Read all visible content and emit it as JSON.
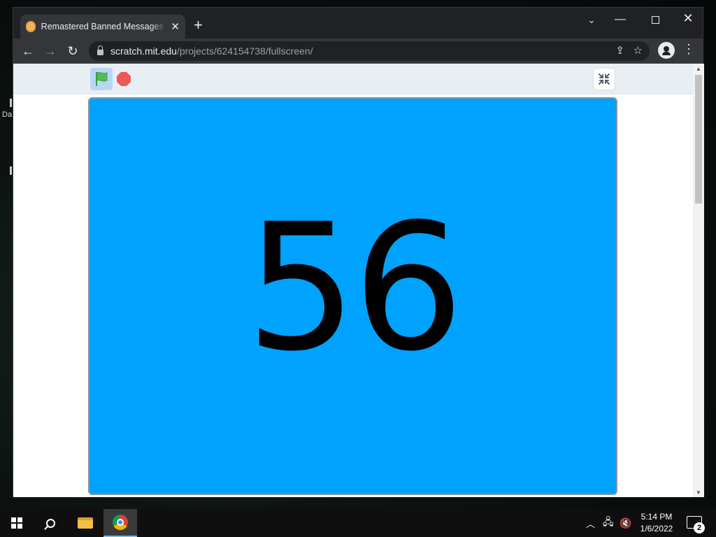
{
  "desktop": {
    "partial_label": "Da"
  },
  "browser": {
    "tab_title": "Remastered Banned Messages Pa",
    "url_host": "scratch.mit.edu",
    "url_path": "/projects/624154738/fullscreen/"
  },
  "stage": {
    "display_number": "56",
    "background_color": "#00a2ff"
  },
  "taskbar": {
    "time": "5:14 PM",
    "date": "1/6/2022",
    "notification_count": "2"
  }
}
